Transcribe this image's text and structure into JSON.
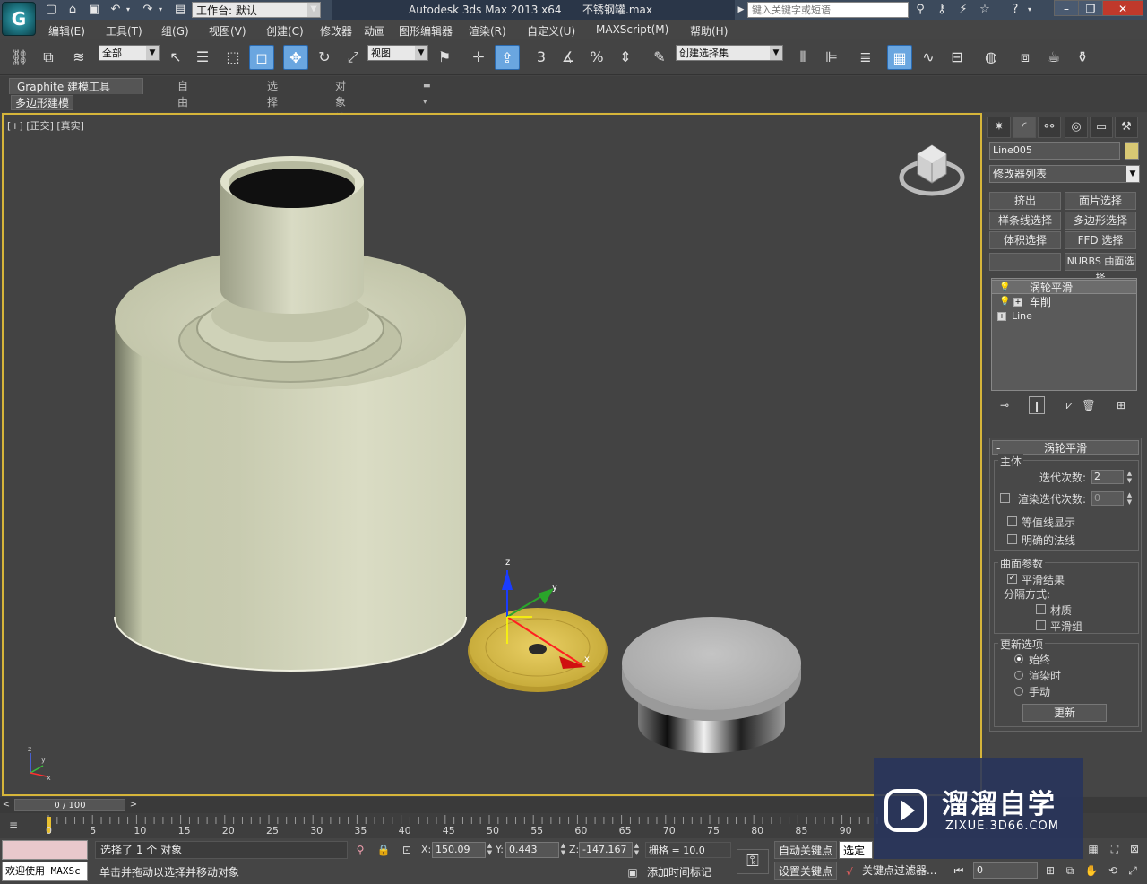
{
  "titlebar": {
    "workspace": "工作台: 默认",
    "app_title": "Autodesk 3ds Max  2013 x64",
    "file_name": "不锈钢罐.max",
    "search_placeholder": "键入关键字或短语",
    "help": "?"
  },
  "menu": [
    "编辑(E)",
    "工具(T)",
    "组(G)",
    "视图(V)",
    "创建(C)",
    "修改器",
    "动画",
    "图形编辑器",
    "渲染(R)",
    "自定义(U)",
    "MAXScript(M)",
    "帮助(H)"
  ],
  "toolbar": {
    "selection_filter": "全部",
    "ref_coord": "视图",
    "snap_3": "3",
    "named_selection": "创建选择集"
  },
  "ribbon": {
    "tabs": [
      "Graphite 建模工具",
      "自由形式",
      "选择",
      "对象绘制"
    ],
    "active_tab": 0,
    "sub_label": "多边形建模"
  },
  "viewport": {
    "label": "[+] [正交] [真实]",
    "axis_labels": [
      "z",
      "y",
      "x"
    ]
  },
  "command_panel": {
    "object_name": "Line005",
    "object_color": "#d8c874",
    "modifier_list": "修改器列表",
    "quick_buttons": [
      "挤出",
      "面片选择",
      "样条线选择",
      "多边形选择",
      "体积选择",
      "FFD 选择",
      "",
      "NURBS 曲面选择"
    ],
    "stack": [
      {
        "name": "涡轮平滑",
        "selected": true,
        "bulb": true,
        "plus": false
      },
      {
        "name": "车削",
        "selected": false,
        "bulb": true,
        "plus": true
      },
      {
        "name": "Line",
        "selected": false,
        "bulb": false,
        "plus": true
      }
    ],
    "rollout": {
      "title": "涡轮平滑",
      "main_group": "主体",
      "iterations_label": "迭代次数:",
      "iterations": "2",
      "render_iters_label": "渲染迭代次数:",
      "render_iters": "0",
      "render_iters_checked": false,
      "isoline_label": "等值线显示",
      "isoline_checked": false,
      "explicit_normals_label": "明确的法线",
      "explicit_normals_checked": false,
      "surface_group": "曲面参数",
      "smooth_result_label": "平滑结果",
      "smooth_result_checked": true,
      "separate_by_label": "分隔方式:",
      "materials_label": "材质",
      "materials_checked": false,
      "smoothing_groups_label": "平滑组",
      "smoothing_groups_checked": false,
      "update_group": "更新选项",
      "always_label": "始终",
      "when_rendering_label": "渲染时",
      "manually_label": "手动",
      "update_option": "always",
      "update_button": "更新"
    }
  },
  "timeline": {
    "frame_display": "0 / 100",
    "ticks": [
      "0",
      "5",
      "10",
      "15",
      "20",
      "25",
      "30",
      "35",
      "40",
      "45",
      "50",
      "55",
      "60",
      "65",
      "70",
      "75",
      "80",
      "85",
      "90"
    ]
  },
  "status": {
    "welcome": "欢迎使用 MAXSc",
    "selection": "选择了 1 个 对象",
    "prompt": "单击并拖动以选择并移动对象",
    "x_label": "X:",
    "x": "150.09",
    "y_label": "Y:",
    "y": "0.443",
    "z_label": "Z:",
    "z": "-147.167",
    "grid": "栅格 = 10.0",
    "add_time_tag": "添加时间标记",
    "auto_key": "自动关键点",
    "selected_dropdown": "选定对",
    "set_key": "设置关键点",
    "key_filters": "关键点过滤器...",
    "frame": "0"
  },
  "watermark": {
    "title": "溜溜自学",
    "url": "ZIXUE.3D66.COM"
  }
}
